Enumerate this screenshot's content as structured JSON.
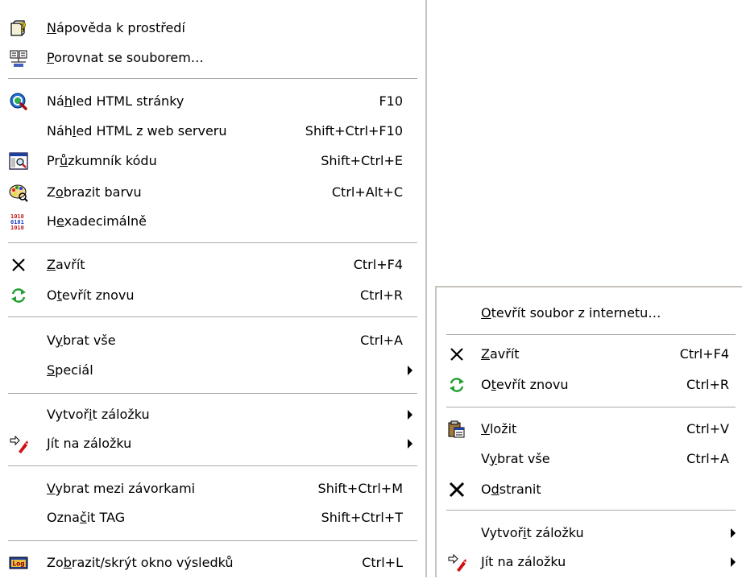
{
  "menu1": {
    "items": [
      {
        "label_pre": "",
        "label_u": "N",
        "label_post": "ápověda k prostředí",
        "shortcut": "",
        "icon": "help-icon"
      },
      {
        "label_pre": "",
        "label_u": "P",
        "label_post": "orovnat se souborem…",
        "shortcut": "",
        "icon": "compare-files-icon"
      },
      {
        "label_pre": "Ná",
        "label_u": "h",
        "label_post": "led HTML stránky",
        "shortcut": "F10",
        "icon": "html-preview-icon"
      },
      {
        "label_pre": "Náh",
        "label_u": "l",
        "label_post": "ed HTML z web serveru",
        "shortcut": "Shift+Ctrl+F10",
        "icon": ""
      },
      {
        "label_pre": "Pr",
        "label_u": "ů",
        "label_post": "zkumník kódu",
        "shortcut": "Shift+Ctrl+E",
        "icon": "code-explorer-icon"
      },
      {
        "label_pre": "Z",
        "label_u": "o",
        "label_post": "brazit barvu",
        "shortcut": "Ctrl+Alt+C",
        "icon": "color-palette-icon"
      },
      {
        "label_pre": "H",
        "label_u": "e",
        "label_post": "xadecimálně",
        "shortcut": "",
        "icon": "hex-icon"
      },
      {
        "label_pre": "",
        "label_u": "Z",
        "label_post": "avřít",
        "shortcut": "Ctrl+F4",
        "icon": "close-icon"
      },
      {
        "label_pre": "O",
        "label_u": "t",
        "label_post": "evřít znovu",
        "shortcut": "Ctrl+R",
        "icon": "reload-icon"
      },
      {
        "label_pre": "V",
        "label_u": "y",
        "label_post": "brat vše",
        "shortcut": "Ctrl+A",
        "icon": ""
      },
      {
        "label_pre": "",
        "label_u": "S",
        "label_post": "peciál",
        "shortcut": "",
        "icon": "",
        "submenu": true
      },
      {
        "label_pre": "Vytvoř",
        "label_u": "i",
        "label_post": "t záložku",
        "shortcut": "",
        "icon": "",
        "submenu": true
      },
      {
        "label_pre": "",
        "label_u": "J",
        "label_post": "ít na záložku",
        "shortcut": "",
        "icon": "goto-bookmark-icon",
        "submenu": true
      },
      {
        "label_pre": "",
        "label_u": "V",
        "label_post": "ybrat mezi závorkami",
        "shortcut": "Shift+Ctrl+M",
        "icon": ""
      },
      {
        "label_pre": "Ozna",
        "label_u": "č",
        "label_post": "it TAG",
        "shortcut": "Shift+Ctrl+T",
        "icon": ""
      },
      {
        "label_pre": "Zo",
        "label_u": "b",
        "label_post": "razit/skrýt okno výsledků",
        "shortcut": "Ctrl+L",
        "icon": "log-window-icon"
      }
    ],
    "log_badge": "Log"
  },
  "menu2": {
    "items": [
      {
        "label_pre": "",
        "label_u": "O",
        "label_post": "tevřít soubor z internetu…",
        "shortcut": "",
        "icon": ""
      },
      {
        "label_pre": "",
        "label_u": "Z",
        "label_post": "avřít",
        "shortcut": "Ctrl+F4",
        "icon": "close-icon"
      },
      {
        "label_pre": "O",
        "label_u": "t",
        "label_post": "evřít znovu",
        "shortcut": "Ctrl+R",
        "icon": "reload-icon"
      },
      {
        "label_pre": "",
        "label_u": "V",
        "label_post": "ložit",
        "shortcut": "Ctrl+V",
        "icon": "paste-icon"
      },
      {
        "label_pre": "V",
        "label_u": "y",
        "label_post": "brat vše",
        "shortcut": "Ctrl+A",
        "icon": ""
      },
      {
        "label_pre": "O",
        "label_u": "d",
        "label_post": "stranit",
        "shortcut": "",
        "icon": "delete-icon"
      },
      {
        "label_pre": "Vytvoř",
        "label_u": "i",
        "label_post": "t záložku",
        "shortcut": "",
        "icon": "",
        "submenu": true
      },
      {
        "label_pre": "",
        "label_u": "J",
        "label_post": "ít na záložku",
        "shortcut": "",
        "icon": "goto-bookmark-icon",
        "submenu": true
      }
    ]
  }
}
